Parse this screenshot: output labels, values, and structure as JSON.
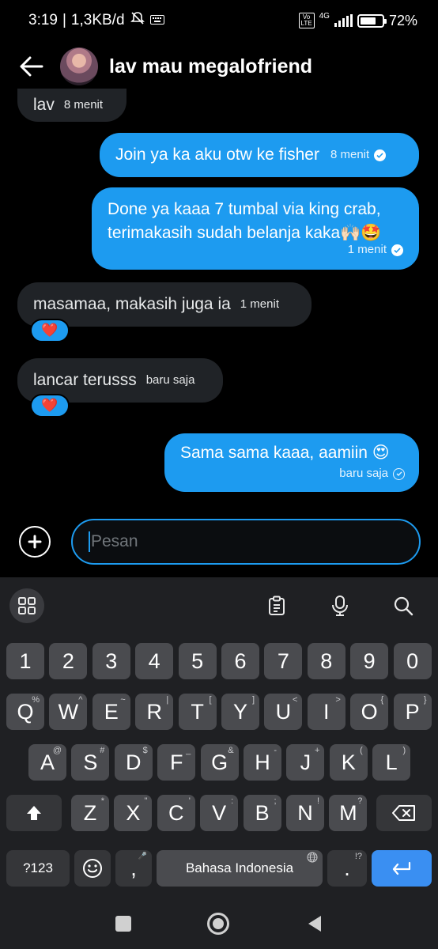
{
  "status_bar": {
    "time": "3:19",
    "data_speed": "1,3KB/d",
    "network_type": "4G",
    "volte": "Vo LTE",
    "battery": "72%"
  },
  "header": {
    "title": "lav mau megalofriend"
  },
  "messages": [
    {
      "direction": "in",
      "text": "lav",
      "time": "8 menit"
    },
    {
      "direction": "out",
      "text": "Join ya ka aku otw ke fisher",
      "time": "8 menit",
      "status": "read"
    },
    {
      "direction": "out",
      "text_line1": "Done ya kaaa 7 tumbal via king crab,",
      "text_line2": "terimakasih sudah belanja kaka",
      "emoji": "🙌🏻🤩",
      "time": "1 menit",
      "status": "read"
    },
    {
      "direction": "in",
      "text": "masamaa, makasih juga ia",
      "time": "1 menit",
      "reaction": "❤️"
    },
    {
      "direction": "in",
      "text": "lancar terusss",
      "time": "baru saja",
      "reaction": "❤️"
    },
    {
      "direction": "out",
      "text": "Sama sama kaaa, aamiin",
      "emoji": "😍",
      "time": "baru saja",
      "status": "sent"
    }
  ],
  "composer": {
    "placeholder": "Pesan"
  },
  "keyboard": {
    "number_row": [
      "1",
      "2",
      "3",
      "4",
      "5",
      "6",
      "7",
      "8",
      "9",
      "0"
    ],
    "row1": [
      {
        "k": "Q",
        "h": "%"
      },
      {
        "k": "W",
        "h": "^"
      },
      {
        "k": "E",
        "h": "~"
      },
      {
        "k": "R",
        "h": "|"
      },
      {
        "k": "T",
        "h": "["
      },
      {
        "k": "Y",
        "h": "]"
      },
      {
        "k": "U",
        "h": "<"
      },
      {
        "k": "I",
        "h": ">"
      },
      {
        "k": "O",
        "h": "{"
      },
      {
        "k": "P",
        "h": "}"
      }
    ],
    "row2": [
      {
        "k": "A",
        "h": "@"
      },
      {
        "k": "S",
        "h": "#"
      },
      {
        "k": "D",
        "h": "$"
      },
      {
        "k": "F",
        "h": "_"
      },
      {
        "k": "G",
        "h": "&"
      },
      {
        "k": "H",
        "h": "-"
      },
      {
        "k": "J",
        "h": "+"
      },
      {
        "k": "K",
        "h": "("
      },
      {
        "k": "L",
        "h": ")"
      }
    ],
    "row3": [
      {
        "k": "Z",
        "h": "*"
      },
      {
        "k": "X",
        "h": "\""
      },
      {
        "k": "C",
        "h": "'"
      },
      {
        "k": "V",
        "h": ":"
      },
      {
        "k": "B",
        "h": ";"
      },
      {
        "k": "N",
        "h": "!"
      },
      {
        "k": "M",
        "h": "?"
      }
    ],
    "symbols_label": "?123",
    "comma": ",",
    "comma_hint": "🎤",
    "space_label": "Bahasa Indonesia",
    "period": ".",
    "period_hint": "!?"
  },
  "colors": {
    "accent": "#1d9bf0",
    "incoming_bubble": "#202327",
    "background": "#000000",
    "keyboard_bg": "#1f2023",
    "key": "#4a4b4f",
    "enter_key": "#3a8ff2"
  }
}
